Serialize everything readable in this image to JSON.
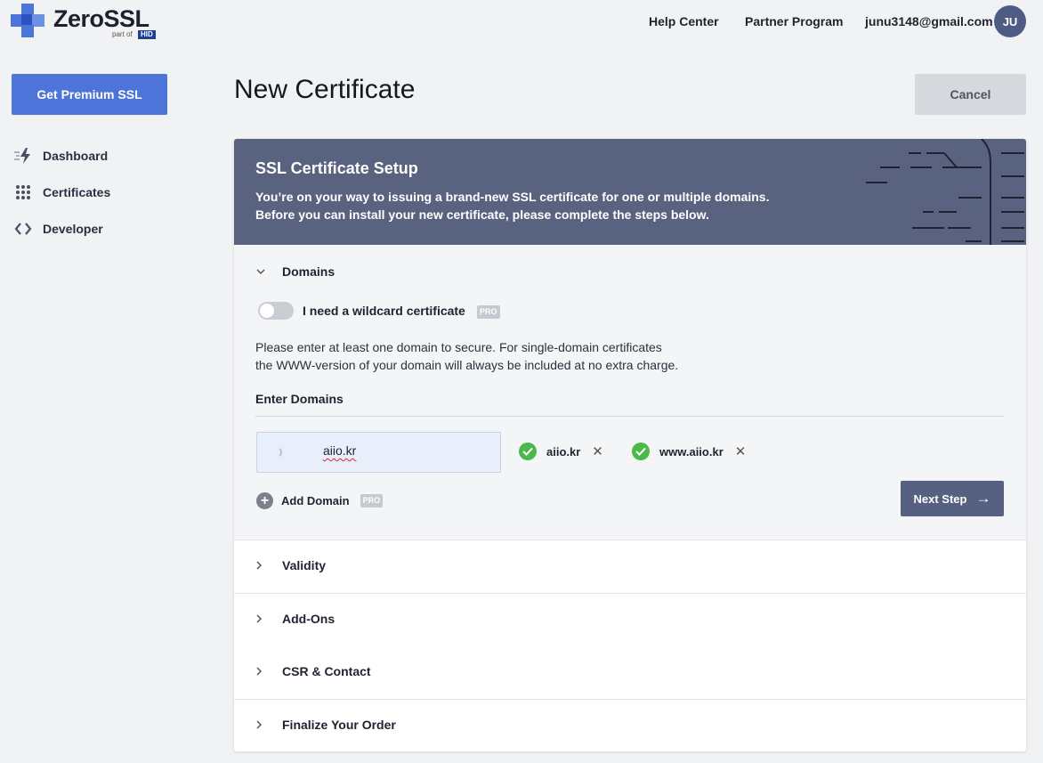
{
  "brand": {
    "name": "ZeroSSL",
    "sub": "part of",
    "parent": "HID"
  },
  "header": {
    "help_center": "Help Center",
    "partner_program": "Partner Program",
    "email": "junu3148@gmail.com",
    "avatar_initials": "JU"
  },
  "sidebar": {
    "premium_button": "Get Premium SSL",
    "items": [
      {
        "label": "Dashboard",
        "icon": "bolt-icon"
      },
      {
        "label": "Certificates",
        "icon": "grid-dots-icon"
      },
      {
        "label": "Developer",
        "icon": "code-brackets-icon"
      }
    ]
  },
  "page": {
    "title": "New Certificate",
    "cancel_button": "Cancel"
  },
  "setup": {
    "title": "SSL Certificate Setup",
    "desc_line1": "You’re on your way to issuing a brand-new SSL certificate for one or multiple domains.",
    "desc_line2": "Before you can install your new certificate, please complete the steps below."
  },
  "domains": {
    "heading": "Domains",
    "wildcard_label": "I need a wildcard certificate",
    "pro_badge": "PRO",
    "info_line1": "Please enter at least one domain to secure. For single-domain certificates",
    "info_line2": "the WWW-version of your domain will always be included at no extra charge.",
    "enter_label": "Enter Domains",
    "input_value": "aiio.kr",
    "chips": [
      "aiio.kr",
      "www.aiio.kr"
    ],
    "add_domain": "Add Domain",
    "next_step": "Next Step"
  },
  "steps": [
    "Validity",
    "Add-Ons",
    "CSR & Contact",
    "Finalize Your Order"
  ],
  "colors": {
    "accent": "#4d74d8",
    "header_bg": "#59627f",
    "success": "#4cb84b"
  }
}
